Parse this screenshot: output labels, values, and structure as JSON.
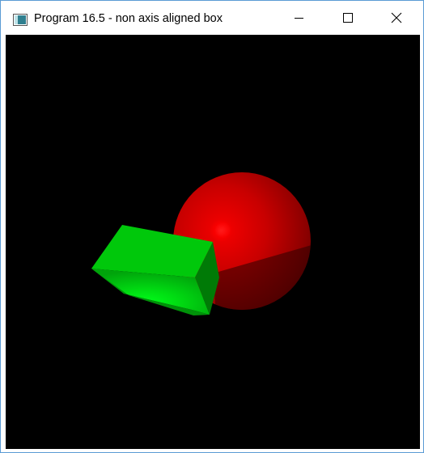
{
  "window": {
    "title": "Program 16.5 - non axis aligned box"
  },
  "controls": {
    "minimize_icon": "minimize-icon",
    "maximize_icon": "maximize-icon",
    "close_icon": "close-icon"
  },
  "scene": {
    "background": "#000000",
    "objects": [
      {
        "name": "sphere",
        "color": "#cc0000"
      },
      {
        "name": "box",
        "color": "#00cc00"
      }
    ]
  }
}
